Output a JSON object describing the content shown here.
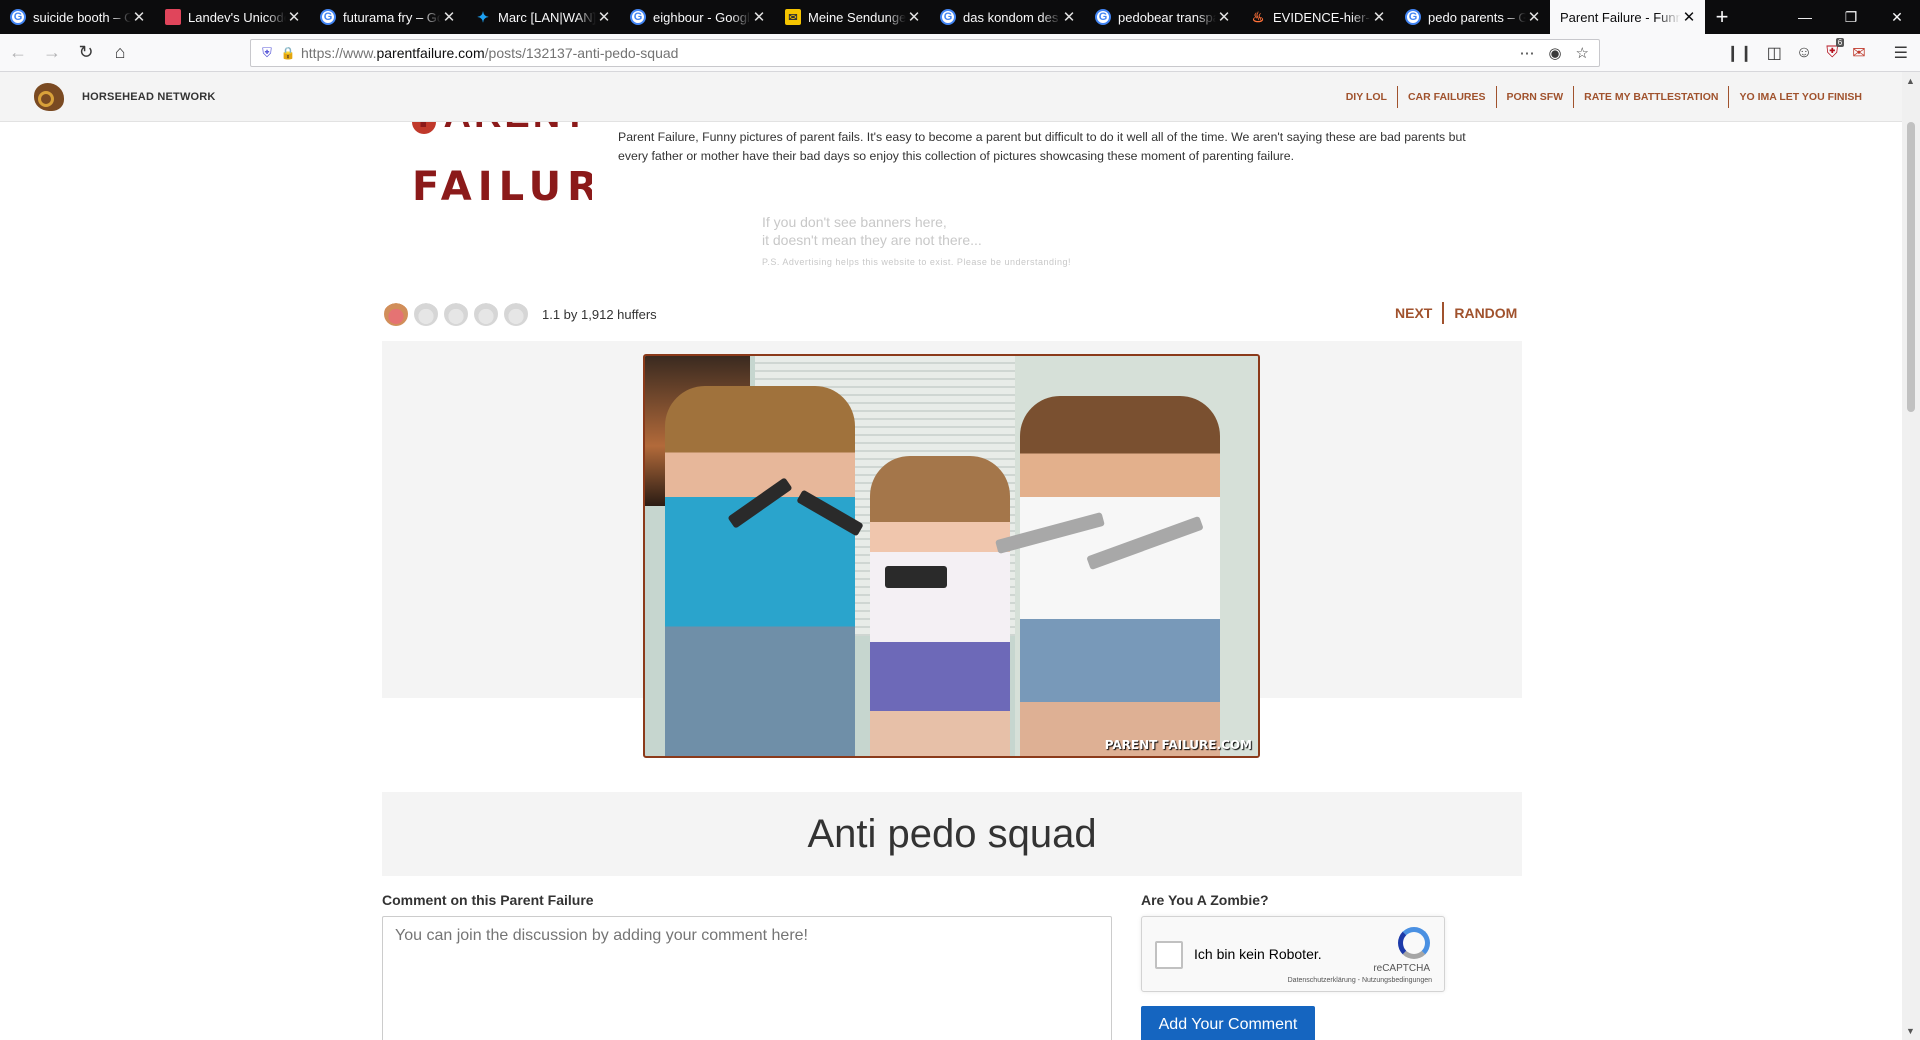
{
  "browser": {
    "tabs": [
      {
        "title": "suicide booth – Go",
        "icon": "google"
      },
      {
        "title": "Landev's Unicode",
        "icon": "landev"
      },
      {
        "title": "futurama fry – Go",
        "icon": "google"
      },
      {
        "title": "Marc [LAN|WAN]",
        "icon": "twitter"
      },
      {
        "title": "eighbour - Google",
        "icon": "google"
      },
      {
        "title": "Meine Sendungen",
        "icon": "mail"
      },
      {
        "title": "das kondom des g",
        "icon": "google"
      },
      {
        "title": "pedobear transpa",
        "icon": "google"
      },
      {
        "title": "EVIDENCE-hier-ha",
        "icon": "firefox"
      },
      {
        "title": "pedo parents – Go",
        "icon": "google"
      },
      {
        "title": "Parent Failure - Funny",
        "icon": "none",
        "active": true
      }
    ],
    "url_prefix": "https://www.",
    "url_domain": "parentfailure.com",
    "url_path": "/posts/132137-anti-pedo-squad",
    "addon_badge": "6"
  },
  "network_bar": {
    "name": "HORSEHEAD NETWORK",
    "links": [
      "DIY LOL",
      "CAR FAILURES",
      "PORN SFW",
      "RATE MY BATTLESTATION",
      "YO IMA LET YOU FINISH"
    ]
  },
  "site": {
    "logo_top": "PARENT",
    "logo_bottom": "FAILURE",
    "intro": "Parent Failure, Funny pictures of parent fails. It's easy to become a parent but difficult to do it well all of the time. We aren't saying these are bad parents but every father or mother have their bad days so enjoy this collection of pictures showcasing these moment of parenting failure."
  },
  "ad_notice": {
    "line1": "If you don't see banners here,",
    "line2": "it doesn't mean they are not there...",
    "line3": "P.S. Advertising helps this website to exist. Please be understanding!"
  },
  "post": {
    "rating": 1.1,
    "rating_max": 5,
    "rating_text": "1.1 by 1,912 huffers",
    "next": "NEXT",
    "random": "RANDOM",
    "watermark": "PARENT FAILURE.COM",
    "title": "Anti pedo squad"
  },
  "comments": {
    "label": "Comment on this Parent Failure",
    "placeholder": "You can join the discussion by adding your comment here!",
    "zombie_label": "Are You A Zombie?",
    "captcha_label": "Ich bin kein Roboter.",
    "captcha_brand": "reCAPTCHA",
    "captcha_terms": "Datenschutzerklärung - Nutzungsbedingungen",
    "submit": "Add Your Comment"
  },
  "colors": {
    "accent": "#a0522d",
    "brand": "#8b1a1a",
    "button": "#1565c0"
  }
}
